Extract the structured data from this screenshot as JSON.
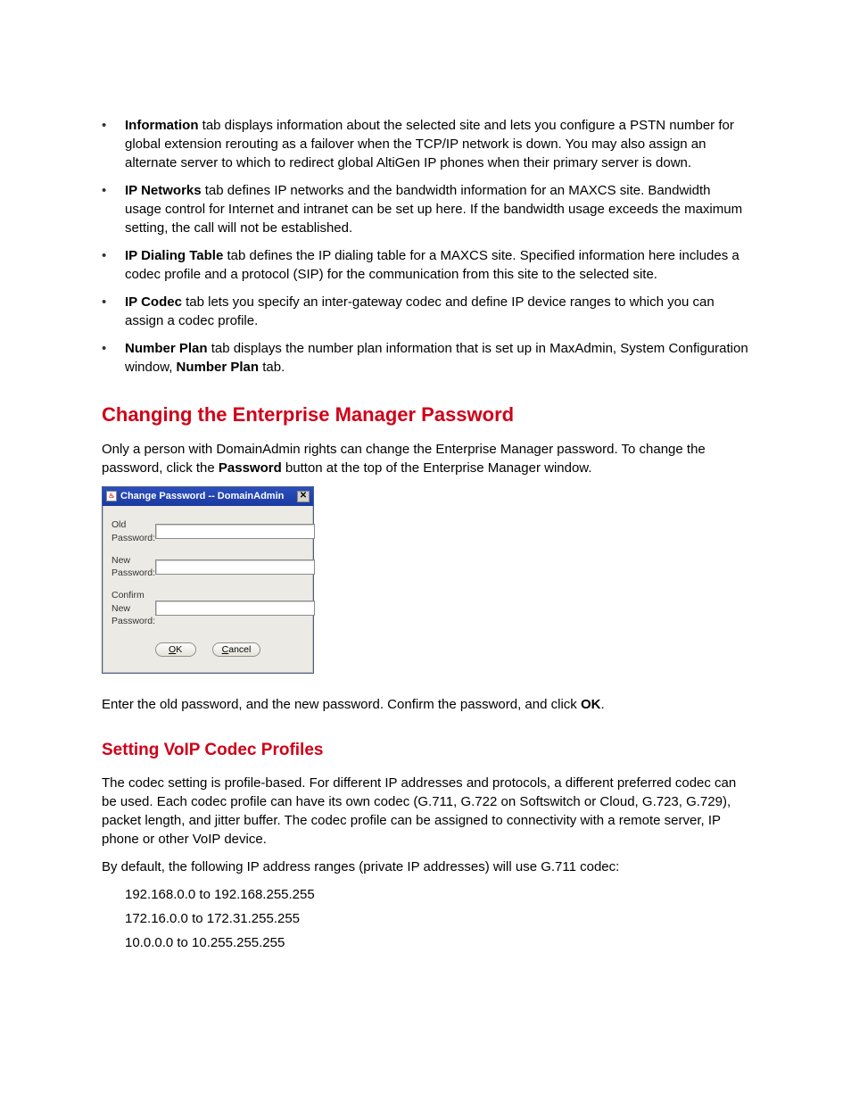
{
  "bullets": [
    {
      "before": "",
      "bold": "Information",
      "after": " tab displays information about the selected site and lets you configure a PSTN number for global extension rerouting as a failover when the TCP/IP network is down. You may also assign an alternate server to which to redirect global AltiGen IP phones when their primary server is down."
    },
    {
      "before": "",
      "bold": "IP Networks",
      "after": " tab defines IP networks and the bandwidth information for an MAXCS site. Bandwidth usage control for Internet and intranet can be set up here. If the bandwidth usage exceeds the maximum setting, the call will not be established."
    },
    {
      "before": "",
      "bold": "IP Dialing Table",
      "after": " tab defines the IP dialing table for a MAXCS site. Specified information here includes a codec profile and a protocol (SIP) for the communication from this site to the selected site."
    },
    {
      "before": "",
      "bold": "IP Codec",
      "after": " tab lets you specify an inter-gateway codec and define IP device ranges to which you can assign a codec profile."
    }
  ],
  "numberplan": {
    "pre": "",
    "bold1": "Number Plan",
    "mid1": " tab displays the number plan information that is set up in MaxAdmin, System Configuration window, ",
    "bold2": "Number Plan",
    "mid2": " tab."
  },
  "pw_heading": "Changing the Enterprise Manager Password",
  "pw_para": {
    "p1a": "Only a person with DomainAdmin rights can change the Enterprise Manager password. To change the password, click the ",
    "bold": "Password",
    "p1b": " button at the top of the Enterprise Manager window."
  },
  "dialog": {
    "title": "Change Password -- DomainAdmin",
    "labels": {
      "old": "Old Password:",
      "new": "New Password:",
      "confirm": "Confirm New Password:"
    },
    "buttons": {
      "ok": "OK",
      "cancel": "Cancel"
    }
  },
  "pw_enter": {
    "a": "Enter the old password, and the new password. Confirm the password, and click ",
    "bold": "OK",
    "b": "."
  },
  "codec_heading": "Setting VoIP Codec Profiles",
  "codec_p1": "The codec setting is profile-based. For different IP addresses and protocols, a different preferred codec can be used. Each codec profile can have its own codec (G.711, G.722 on Softswitch or Cloud, G.723, G.729), packet length, and jitter buffer. The codec profile can be assigned to connectivity with a remote server, IP phone or other VoIP device.",
  "codec_p2": "By default, the following IP address ranges (private IP addresses) will use G.711 codec:",
  "ranges": [
    "192.168.0.0 to 192.168.255.255",
    "172.16.0.0 to 172.31.255.255",
    "10.0.0.0 to 10.255.255.255"
  ]
}
